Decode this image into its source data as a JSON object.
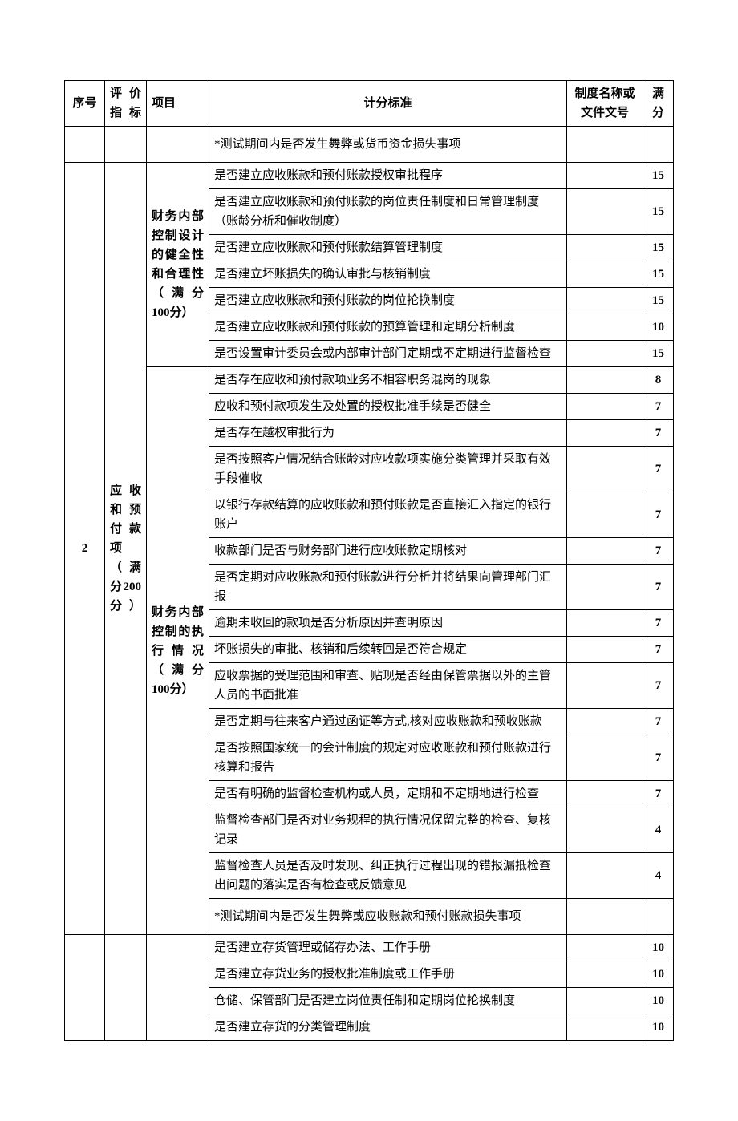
{
  "headers": {
    "seq": "序号",
    "indicator": "评价指标",
    "project": "项目",
    "standard": "计分标准",
    "system": "制度名称或文件文号",
    "score": "满分"
  },
  "pre_row": {
    "standard": "*测试期间内是否发生舞弊或货币资金损失事项"
  },
  "section2": {
    "seq": "2",
    "indicator": "应收和预付款项（满分200分）",
    "group1": {
      "project": "财务内部控制设计的健全性和合理性（满分100分）",
      "rows": [
        {
          "std": "是否建立应收账款和预付账款授权审批程序",
          "score": "15"
        },
        {
          "std": "是否建立应收账款和预付账款的岗位责任制度和日常管理制度（账龄分析和催收制度）",
          "score": "15"
        },
        {
          "std": "是否建立应收账款和预付账款结算管理制度",
          "score": "15"
        },
        {
          "std": "是否建立坏账损失的确认审批与核销制度",
          "score": "15"
        },
        {
          "std": "是否建立应收账款和预付账款的岗位抡换制度",
          "score": "15"
        },
        {
          "std": "是否建立应收账款和预付账款的预算管理和定期分析制度",
          "score": "10"
        },
        {
          "std": "是否设置审计委员会或内部审计部门定期或不定期进行监督检查",
          "score": "15"
        }
      ]
    },
    "group2": {
      "project": "财务内部控制的执行情况（满分100分）",
      "rows": [
        {
          "std": "是否存在应收和预付款项业务不相容职务混岗的现象",
          "score": "8"
        },
        {
          "std": "应收和预付款项发生及处置的授权批准手续是否健全",
          "score": "7"
        },
        {
          "std": "是否存在越权审批行为",
          "score": "7"
        },
        {
          "std": "是否按照客户情况结合账龄对应收款项实施分类管理并采取有效手段催收",
          "score": "7"
        },
        {
          "std": "以银行存款结算的应收账款和预付账款是否直接汇入指定的银行账户",
          "score": "7"
        },
        {
          "std": "收款部门是否与财务部门进行应收账款定期核对",
          "score": "7"
        },
        {
          "std": "是否定期对应收账款和预付账款进行分析并将结果向管理部门汇报",
          "score": "7"
        },
        {
          "std": "逾期未收回的款项是否分析原因并查明原因",
          "score": "7"
        },
        {
          "std": "坏账损失的审批、核销和后续转回是否符合规定",
          "score": "7"
        },
        {
          "std": "应收票据的受理范围和审查、贴现是否经由保管票据以外的主管人员的书面批准",
          "score": "7"
        },
        {
          "std": "是否定期与往来客户通过函证等方式,核对应收账款和预收账款",
          "score": "7"
        },
        {
          "std": "是否按照国家统一的会计制度的规定对应收账款和预付账款进行核算和报告",
          "score": "7"
        },
        {
          "std": "是否有明确的监督检查机构或人员，定期和不定期地进行检查",
          "score": "7"
        },
        {
          "std": "监督检查部门是否对业务规程的执行情况保留完整的检查、复核记录",
          "score": "4"
        },
        {
          "std": "监督检查人员是否及时发现、纠正执行过程出现的错报漏抵检查出问题的落实是否有检查或反馈意见",
          "score": "4"
        },
        {
          "std": "*测试期间内是否发生舞弊或应收账款和预付账款损失事项",
          "score": ""
        }
      ]
    }
  },
  "section3": {
    "rows": [
      {
        "std": "是否建立存货管理或储存办法、工作手册",
        "score": "10"
      },
      {
        "std": "是否建立存货业务的授权批准制度或工作手册",
        "score": "10"
      },
      {
        "std": "仓储、保管部门是否建立岗位责任制和定期岗位抡换制度",
        "score": "10"
      },
      {
        "std": "是否建立存货的分类管理制度",
        "score": "10"
      }
    ]
  }
}
